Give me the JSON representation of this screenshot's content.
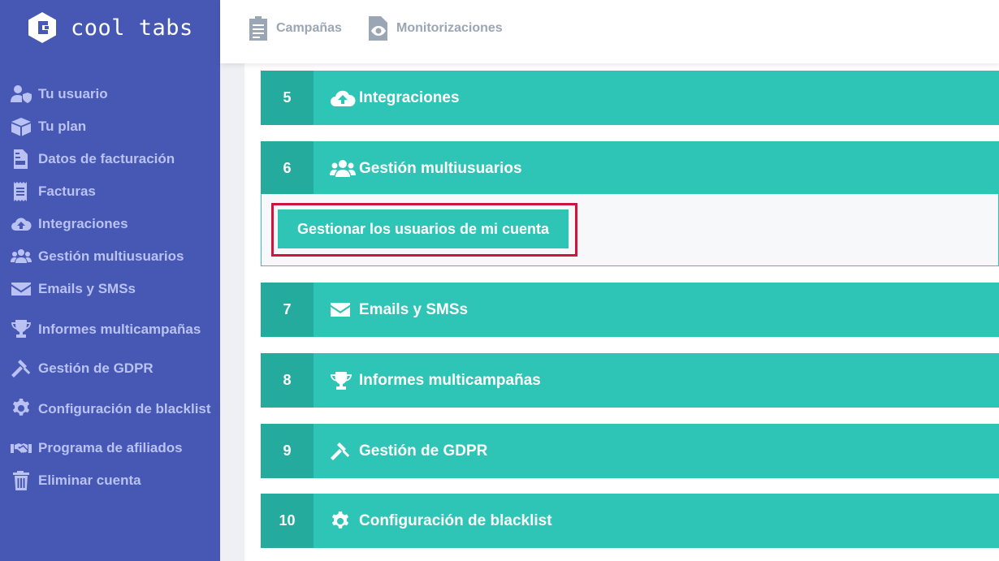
{
  "brand": {
    "name": "cool tabs",
    "logo_icon": "cooltabs-hexagon-logo"
  },
  "sidebar": {
    "items": [
      {
        "label": "Tu usuario",
        "icon": "user-shield-icon"
      },
      {
        "label": "Tu plan",
        "icon": "box-icon"
      },
      {
        "label": "Datos de facturación",
        "icon": "invoice-file-icon"
      },
      {
        "label": "Facturas",
        "icon": "receipt-icon"
      },
      {
        "label": "Integraciones",
        "icon": "cloud-upload-icon"
      },
      {
        "label": "Gestión multiusuarios",
        "icon": "users-icon"
      },
      {
        "label": "Emails y SMSs",
        "icon": "envelope-icon"
      },
      {
        "label": "Informes multicampañas",
        "icon": "trophy-icon"
      },
      {
        "label": "Gestión de GDPR",
        "icon": "gavel-icon"
      },
      {
        "label": "Configuración de blacklist",
        "icon": "gear-icon"
      },
      {
        "label": "Programa de afiliados",
        "icon": "handshake-icon"
      },
      {
        "label": "Eliminar cuenta",
        "icon": "trash-icon"
      }
    ]
  },
  "topbar": {
    "tabs": [
      {
        "label": "Campañas",
        "icon": "clipboard-icon"
      },
      {
        "label": "Monitorizaciones",
        "icon": "eye-document-icon"
      }
    ]
  },
  "sections": [
    {
      "number": "5",
      "title": "Integraciones",
      "icon": "cloud-upload-icon"
    },
    {
      "number": "6",
      "title": "Gestión multiusuarios",
      "icon": "users-icon"
    },
    {
      "number": "7",
      "title": "Emails y SMSs",
      "icon": "envelope-icon"
    },
    {
      "number": "8",
      "title": "Informes multicampañas",
      "icon": "trophy-icon"
    },
    {
      "number": "9",
      "title": "Gestión de GDPR",
      "icon": "gavel-icon"
    },
    {
      "number": "10",
      "title": "Configuración de blacklist",
      "icon": "gear-icon"
    }
  ],
  "multiuser_panel": {
    "button_label": "Gestionar los usuarios de mi cuenta"
  },
  "colors": {
    "sidebar_bg": "#4658b3",
    "sidebar_text": "#b9c2f2",
    "accent": "#2ec4b6",
    "accent_dark": "#25ab9e",
    "highlight": "#d1143f"
  }
}
